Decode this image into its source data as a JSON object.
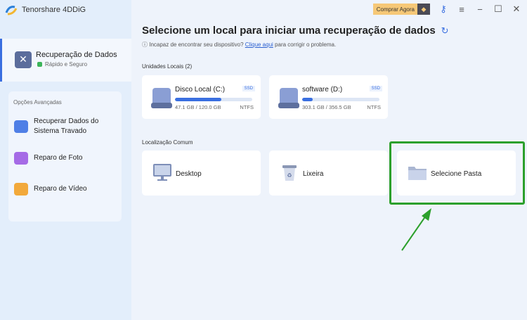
{
  "app": {
    "title": "Tenorshare 4DDiG"
  },
  "topbar": {
    "buy_label": "Comprar Agora"
  },
  "sidebar": {
    "active": {
      "label": "Recuperação de Dados",
      "sub": "Rápido e Seguro"
    },
    "advanced_header": "Opções Avançadas",
    "items": [
      {
        "label": "Recuperar Dados do Sistema Travado"
      },
      {
        "label": "Reparo de Foto"
      },
      {
        "label": "Reparo de Vídeo"
      }
    ]
  },
  "main": {
    "title": "Selecione um local para iniciar uma recuperação de dados",
    "help_prefix": "Incapaz de encontrar seu dispositivo?",
    "help_link": "Clique aqui",
    "help_suffix": "para corrigir o problema.",
    "local_header": "Unidades Locais (2)",
    "drives": [
      {
        "name": "Disco Local (C:)",
        "type": "SSD",
        "size": "47.1 GB / 120.0 GB",
        "fs": "NTFS",
        "bar_fill_percent": 60
      },
      {
        "name": "software (D:)",
        "type": "SSD",
        "size": "303.1 GB / 356.5 GB",
        "fs": "NTFS",
        "bar_fill_percent": 14
      }
    ],
    "common_header": "Localização Comum",
    "locations": [
      {
        "name": "Desktop"
      },
      {
        "name": "Lixeira"
      },
      {
        "name": "Selecione Pasta"
      }
    ]
  },
  "colors": {
    "accent": "#3a6fe0",
    "highlight": "#2ca02c"
  }
}
